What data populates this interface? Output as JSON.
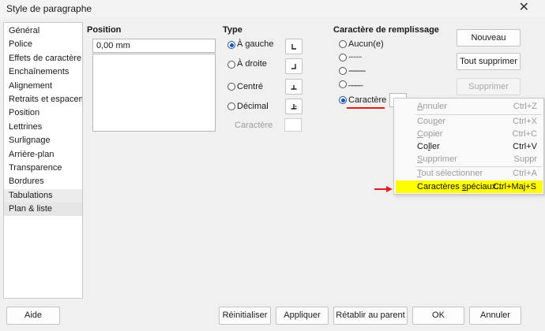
{
  "window": {
    "title": "Style de paragraphe",
    "close": "✕"
  },
  "sidebar": {
    "items": [
      "Général",
      "Police",
      "Effets de caractère",
      "Enchaînements",
      "Alignement",
      "Retraits et espacement",
      "Position",
      "Lettrines",
      "Surlignage",
      "Arrière-plan",
      "Transparence",
      "Bordures",
      "Tabulations",
      "Plan & liste"
    ]
  },
  "position": {
    "label": "Position",
    "value": "0,00 mm"
  },
  "type": {
    "label": "Type",
    "options": [
      "À gauche",
      "À droite",
      "Centré",
      "Décimal"
    ],
    "selected": "À gauche",
    "char_label": "Caractère"
  },
  "fill": {
    "label": "Caractère de remplissage",
    "options": [
      "Aucun(e)",
      "........",
      "--------",
      "____",
      "Caractère"
    ],
    "selected": "Caractère"
  },
  "right_buttons": {
    "new": "Nouveau",
    "delete_all": "Tout supprimer",
    "delete": "Supprimer"
  },
  "context_menu": {
    "items": [
      {
        "label": "Annuler",
        "key": "Ctrl+Z",
        "disabled": true
      },
      {
        "label": "Couper",
        "key": "Ctrl+X",
        "disabled": true
      },
      {
        "label": "Copier",
        "key": "Ctrl+C",
        "disabled": true
      },
      {
        "label": "Coller",
        "key": "Ctrl+V",
        "disabled": false
      },
      {
        "label": "Supprimer",
        "key": "Suppr",
        "disabled": true
      },
      {
        "label": "Tout sélectionner",
        "key": "Ctrl+A",
        "disabled": true
      },
      {
        "label": "Caractères spéciaux...",
        "key": "Ctrl+Maj+S",
        "disabled": false,
        "highlighted": true
      }
    ]
  },
  "bottom_buttons": {
    "help": "Aide",
    "reset": "Réinitialiser",
    "apply": "Appliquer",
    "reset_parent": "Rétablir au parent",
    "ok": "OK",
    "cancel": "Annuler"
  },
  "colors": {
    "highlight": "#fefe00",
    "annotation": "#e01e1e",
    "radio": "#1a55b3"
  }
}
